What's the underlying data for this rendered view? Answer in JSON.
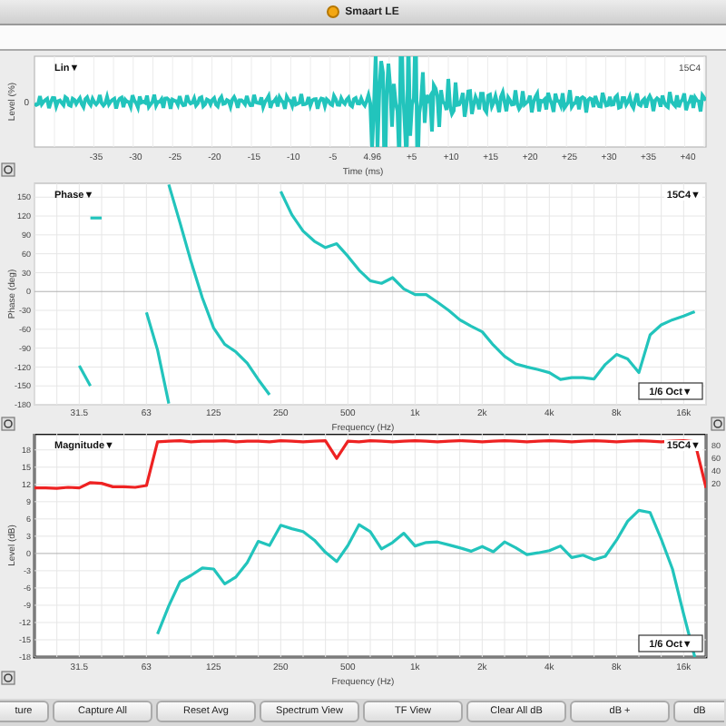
{
  "window": {
    "title": "Smaart LE"
  },
  "time_panel": {
    "menu": "Lin▼",
    "trace_label": "15C4",
    "ylabel": "Level (%)",
    "yticks": [
      "0"
    ],
    "xlabel": "Time (ms)",
    "xticks": [
      "-35",
      "-30",
      "-25",
      "-20",
      "-15",
      "-10",
      "-5",
      "4.96",
      "+5",
      "+10",
      "+15",
      "+20",
      "+25",
      "+30",
      "+35",
      "+40"
    ]
  },
  "phase_panel": {
    "menu": "Phase▼",
    "trace_menu": "15C4▼",
    "smoothing": "1/6 Oct▼",
    "chart_data": {
      "type": "line",
      "grid": true,
      "xlabel": "Frequency (Hz)",
      "ylabel": "Phase (deg)",
      "ylim": [
        -180,
        172
      ],
      "categories": [
        null,
        null,
        null,
        null,
        "31.5",
        null,
        null,
        null,
        null,
        null,
        "63",
        null,
        null,
        null,
        null,
        null,
        "125",
        null,
        null,
        null,
        null,
        null,
        "250",
        null,
        null,
        null,
        null,
        null,
        "500",
        null,
        null,
        null,
        null,
        null,
        "1k",
        null,
        null,
        null,
        null,
        null,
        "2k",
        null,
        null,
        null,
        null,
        null,
        "4k",
        null,
        null,
        null,
        null,
        null,
        "8k",
        null,
        null,
        null,
        null,
        null,
        "16k",
        null,
        null
      ],
      "series": [
        {
          "color": "#22c4bc",
          "values": [
            null,
            null,
            null,
            null,
            -118,
            -150,
            null,
            null,
            null,
            null,
            null,
            null,
            null,
            null,
            null,
            null,
            null,
            null,
            null,
            null,
            null,
            null,
            null,
            null,
            null,
            null,
            null,
            null,
            null,
            null,
            null,
            null,
            null,
            null,
            null,
            null,
            null,
            null,
            null,
            null,
            null,
            null,
            null,
            null,
            null,
            null,
            null,
            null,
            null,
            null,
            null,
            null,
            null,
            null,
            null,
            null,
            null,
            null,
            null,
            null,
            null
          ]
        },
        {
          "color": "#22c4bc",
          "values": [
            null,
            null,
            null,
            null,
            null,
            117,
            117,
            null,
            null,
            null,
            null,
            null,
            null,
            null,
            null,
            null,
            null,
            null,
            null,
            null,
            null,
            null,
            null,
            null,
            null,
            null,
            null,
            null,
            null,
            null,
            null,
            null,
            null,
            null,
            null,
            null,
            null,
            null,
            null,
            null,
            null,
            null,
            null,
            null,
            null,
            null,
            null,
            null,
            null,
            null,
            null,
            null,
            null,
            null,
            null,
            null,
            null,
            null,
            null,
            null,
            null
          ]
        },
        {
          "color": "#22c4bc",
          "values": [
            null,
            null,
            null,
            null,
            null,
            null,
            null,
            null,
            null,
            null,
            -33,
            -93,
            -178,
            null,
            null,
            null,
            null,
            null,
            null,
            null,
            null,
            null,
            null,
            null,
            null,
            null,
            null,
            null,
            null,
            null,
            null,
            null,
            null,
            null,
            null,
            null,
            null,
            null,
            null,
            null,
            null,
            null,
            null,
            null,
            null,
            null,
            null,
            null,
            null,
            null,
            null,
            null,
            null,
            null,
            null,
            null,
            null,
            null,
            null,
            null,
            null
          ]
        },
        {
          "color": "#22c4bc",
          "values": [
            null,
            null,
            null,
            null,
            null,
            null,
            null,
            null,
            null,
            null,
            null,
            null,
            170,
            109,
            47,
            -10,
            -58,
            -84,
            -96,
            -114,
            -140,
            -164,
            null,
            null,
            null,
            null,
            null,
            null,
            null,
            null,
            null,
            null,
            null,
            null,
            null,
            null,
            null,
            null,
            null,
            null,
            null,
            null,
            null,
            null,
            null,
            null,
            null,
            null,
            null,
            null,
            null,
            null,
            null,
            null,
            null,
            null,
            null,
            null,
            null,
            null,
            null
          ]
        },
        {
          "color": "#22c4bc",
          "values": [
            null,
            null,
            null,
            null,
            null,
            null,
            null,
            null,
            null,
            null,
            null,
            null,
            null,
            null,
            null,
            null,
            null,
            null,
            null,
            null,
            null,
            null,
            159,
            122,
            96,
            80,
            70,
            76,
            56,
            34,
            17,
            13,
            22,
            4,
            -5,
            -5,
            -17,
            -30,
            -45,
            -55,
            -64,
            -85,
            -103,
            -115,
            -120,
            -124,
            -129,
            -140,
            -137,
            -137,
            -139,
            -116,
            -100,
            -107,
            -129,
            -69,
            -53,
            -45,
            -39,
            -32,
            null
          ]
        }
      ],
      "yticks": [
        150,
        120,
        90,
        60,
        30,
        0,
        -30,
        -60,
        -90,
        -120,
        -150,
        -180
      ]
    }
  },
  "magnitude_panel": {
    "menu": "Magnitude▼",
    "trace_menu": "15C4▼",
    "smoothing": "1/6 Oct▼",
    "right_axis_labels": [
      "80",
      "60",
      "40",
      "20"
    ],
    "chart_data": {
      "type": "line",
      "grid": true,
      "xlabel": "Frequency (Hz)",
      "ylabel": "Level (dB)",
      "ylim": [
        -18,
        20.8
      ],
      "categories": [
        null,
        null,
        null,
        null,
        "31.5",
        null,
        null,
        null,
        null,
        null,
        "63",
        null,
        null,
        null,
        null,
        null,
        "125",
        null,
        null,
        null,
        null,
        null,
        "250",
        null,
        null,
        null,
        null,
        null,
        "500",
        null,
        null,
        null,
        null,
        null,
        "1k",
        null,
        null,
        null,
        null,
        null,
        "2k",
        null,
        null,
        null,
        null,
        null,
        "4k",
        null,
        null,
        null,
        null,
        null,
        "8k",
        null,
        null,
        null,
        null,
        null,
        "16k",
        null,
        null
      ],
      "series": [
        {
          "color": "#ee2222",
          "values": [
            11.4,
            11.4,
            11.3,
            11.5,
            11.4,
            12.3,
            12.2,
            11.6,
            11.6,
            11.5,
            11.8,
            19.4,
            19.5,
            19.6,
            19.4,
            19.5,
            19.5,
            19.6,
            19.4,
            19.5,
            19.5,
            19.4,
            19.6,
            19.5,
            19.4,
            19.5,
            19.6,
            16.5,
            19.5,
            19.4,
            19.6,
            19.5,
            19.4,
            19.5,
            19.6,
            19.5,
            19.4,
            19.5,
            19.6,
            19.5,
            19.4,
            19.5,
            19.6,
            19.5,
            19.4,
            19.5,
            19.6,
            19.5,
            19.4,
            19.5,
            19.6,
            19.5,
            19.4,
            19.5,
            19.6,
            19.5,
            19.4,
            19.5,
            19.6,
            19.4,
            11.4
          ]
        },
        {
          "color": "#22c4bc",
          "values": [
            null,
            null,
            null,
            null,
            null,
            null,
            null,
            null,
            null,
            null,
            null,
            -14,
            -9.1,
            -4.9,
            -3.8,
            -2.5,
            -2.7,
            -5.3,
            -4.1,
            -1.6,
            2.1,
            1.4,
            4.9,
            4.3,
            3.8,
            2.3,
            0.2,
            -1.4,
            1.4,
            5.0,
            3.8,
            0.8,
            1.9,
            3.5,
            1.3,
            1.9,
            2.0,
            1.5,
            1.0,
            0.4,
            1.2,
            0.3,
            2.0,
            1.0,
            -0.2,
            0.1,
            0.5,
            1.3,
            -0.7,
            -0.3,
            -1.1,
            -0.5,
            2.3,
            5.6,
            7.5,
            7.1,
            2.5,
            -2.7,
            -10.6,
            -18,
            null
          ]
        }
      ],
      "yticks": [
        18,
        15,
        12,
        9,
        6,
        3,
        0,
        -3,
        -6,
        -9,
        -12,
        -15,
        -18
      ]
    }
  },
  "buttons": [
    {
      "label": "ture"
    },
    {
      "label": "Capture All"
    },
    {
      "label": "Reset Avg"
    },
    {
      "label": "Spectrum View"
    },
    {
      "label": "TF View"
    },
    {
      "label": "Clear All dB"
    },
    {
      "label": "dB +"
    },
    {
      "label": "dB"
    }
  ]
}
